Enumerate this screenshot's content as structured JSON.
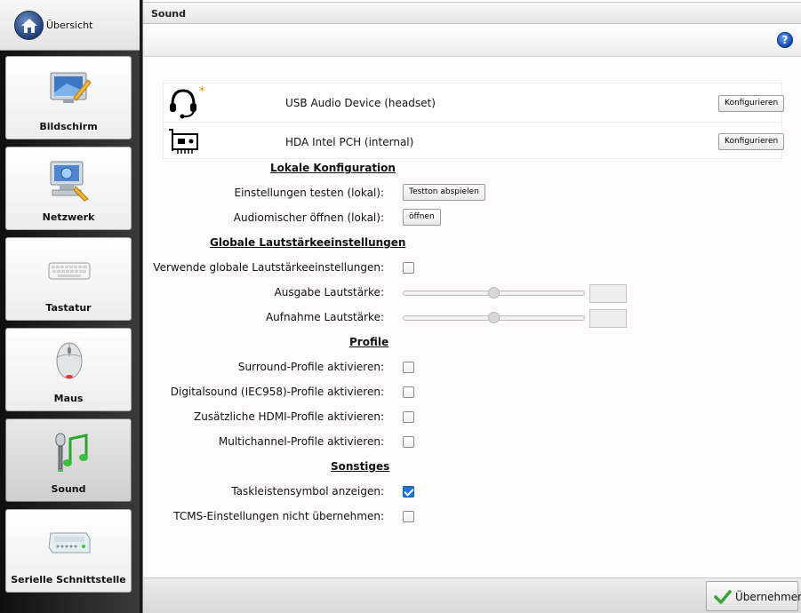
{
  "home": {
    "label": "Übersicht"
  },
  "sidebar": {
    "items": [
      {
        "label": "Bildschirm",
        "icon": "monitor-pen-icon"
      },
      {
        "label": "Netzwerk",
        "icon": "network-computer-icon"
      },
      {
        "label": "Tastatur",
        "icon": "keyboard-icon"
      },
      {
        "label": "Maus",
        "icon": "mouse-icon"
      },
      {
        "label": "Sound",
        "icon": "microphone-note-icon",
        "active": true
      },
      {
        "label": "Serielle Schnittstelle",
        "icon": "serial-device-icon"
      }
    ]
  },
  "header": {
    "title": "Sound",
    "help": "?"
  },
  "devices": [
    {
      "name": "USB Audio Device (headset)",
      "icon": "headset-icon",
      "default_marker": "*",
      "button": "Konfigurieren"
    },
    {
      "name": "HDA Intel PCH (internal)",
      "icon": "soundcard-icon",
      "button": "Konfigurieren"
    }
  ],
  "local": {
    "heading": "Lokale Konfiguration",
    "test_label": "Einstellungen testen (lokal):",
    "test_button": "Testton abspielen",
    "mixer_label": "Audiomischer öffnen (lokal):",
    "mixer_button": "öffnen"
  },
  "global": {
    "heading": "Globale Lautstärkeeinstellungen",
    "use_label": "Verwende globale Lautstärkeeinstellungen:",
    "use_checked": false,
    "output_label": "Ausgabe Lautstärke:",
    "output_level": 0.5,
    "input_label": "Aufnahme Lautstärke:",
    "input_level": 0.5
  },
  "profiles": {
    "heading": "Profile",
    "items": [
      {
        "label": "Surround-Profile aktivieren:",
        "checked": false
      },
      {
        "label": "Digitalsound (IEC958)-Profile aktivieren:",
        "checked": false
      },
      {
        "label": "Zusätzliche HDMI-Profile aktivieren:",
        "checked": false
      },
      {
        "label": "Multichannel-Profile aktivieren:",
        "checked": false
      }
    ]
  },
  "other": {
    "heading": "Sonstiges",
    "items": [
      {
        "label": "Taskleistensymbol anzeigen:",
        "checked": true
      },
      {
        "label": "TCMS-Einstellungen nicht übernehmen:",
        "checked": false
      }
    ]
  },
  "footer": {
    "apply_label": "Übernehmen"
  }
}
